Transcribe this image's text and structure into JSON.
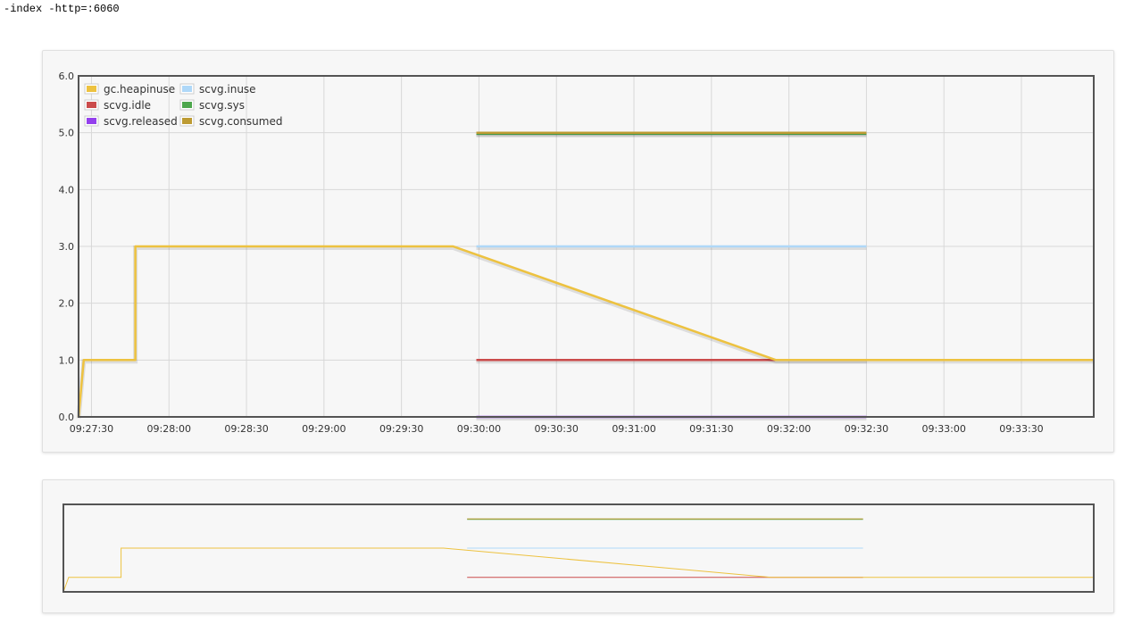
{
  "header": {
    "command_text": "-index -http=:6060"
  },
  "colors": {
    "gc.heapinuse": "#edc240",
    "scvg.inuse": "#afd8f8",
    "scvg.idle": "#cb4b4b",
    "scvg.sys": "#4da74d",
    "scvg.released": "#9440ed",
    "scvg.consumed": "#bd9b33"
  },
  "chart_data": [
    {
      "type": "line",
      "x_axis": "time",
      "xlim": [
        "09:27:25",
        "09:33:58"
      ],
      "ylim": [
        0,
        6
      ],
      "y_ticks": [
        "0.0",
        "1.0",
        "2.0",
        "3.0",
        "4.0",
        "5.0",
        "6.0"
      ],
      "x_ticks": [
        "09:27:30",
        "09:28:00",
        "09:28:30",
        "09:29:00",
        "09:29:30",
        "09:30:00",
        "09:30:30",
        "09:31:00",
        "09:31:30",
        "09:32:00",
        "09:32:30",
        "09:33:00",
        "09:33:30"
      ],
      "grid": true,
      "legend_position": "top-left",
      "series": [
        {
          "name": "gc.heapinuse",
          "points": [
            [
              "09:27:25",
              0
            ],
            [
              "09:27:27",
              1
            ],
            [
              "09:27:47",
              1
            ],
            [
              "09:27:47",
              3
            ],
            [
              "09:29:50",
              3
            ],
            [
              "09:31:55",
              1
            ],
            [
              "09:33:58",
              1
            ]
          ]
        },
        {
          "name": "scvg.inuse",
          "points": [
            [
              "09:29:59",
              3
            ],
            [
              "09:32:30",
              3
            ]
          ]
        },
        {
          "name": "scvg.idle",
          "points": [
            [
              "09:29:59",
              1
            ],
            [
              "09:32:30",
              1
            ]
          ]
        },
        {
          "name": "scvg.sys",
          "points": [
            [
              "09:29:59",
              4.98
            ],
            [
              "09:32:30",
              4.98
            ]
          ]
        },
        {
          "name": "scvg.released",
          "points": [
            [
              "09:29:59",
              0
            ],
            [
              "09:32:30",
              0
            ]
          ]
        },
        {
          "name": "scvg.consumed",
          "points": [
            [
              "09:29:59",
              5
            ],
            [
              "09:32:30",
              5
            ]
          ]
        }
      ]
    },
    {
      "type": "line",
      "role": "overview",
      "xlim": [
        "09:27:25",
        "09:33:58"
      ],
      "ylim": [
        0,
        6
      ],
      "grid": false,
      "series_ref": "same as main chart"
    }
  ]
}
